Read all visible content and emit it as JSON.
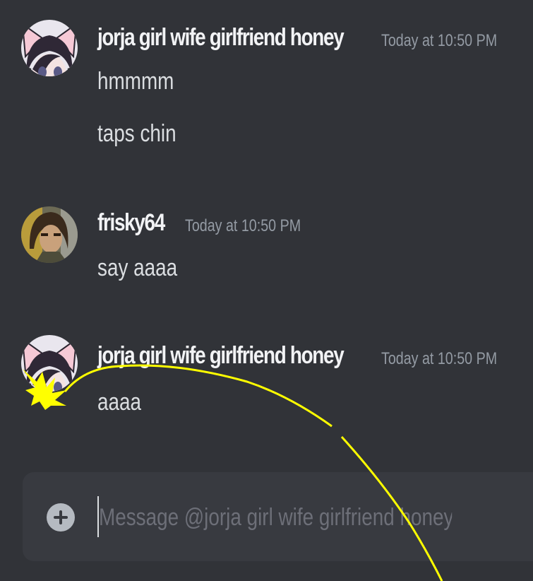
{
  "messages": [
    {
      "author": "jorja girl wife girlfriend honey",
      "timestamp": "Today at 10:50 PM",
      "lines": [
        "hmmmm",
        "taps chin"
      ]
    },
    {
      "author": "frisky64",
      "timestamp": "Today at 10:50 PM",
      "lines": [
        "say aaaa"
      ]
    },
    {
      "author": "jorja girl wife girlfriend honey",
      "timestamp": "Today at 10:50 PM",
      "lines": [
        "aaaa"
      ]
    }
  ],
  "composer": {
    "placeholder": "Message @jorja girl wife girlfriend honey",
    "add_icon": "plus-circle-icon"
  },
  "colors": {
    "background": "#313338",
    "composer_bg": "#383a40",
    "doodle": "#ffff00"
  }
}
